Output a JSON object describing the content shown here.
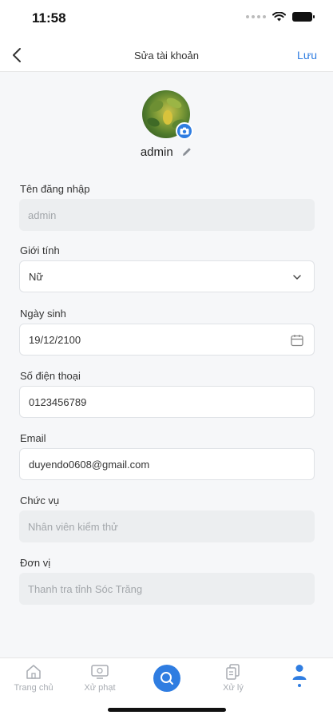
{
  "status_bar": {
    "time": "11:58"
  },
  "header": {
    "title": "Sửa tài khoản",
    "save_label": "Lưu"
  },
  "profile": {
    "username": "admin"
  },
  "fields": [
    {
      "label": "Tên đăng nhập",
      "value": "admin",
      "state": "disabled"
    },
    {
      "label": "Giới tính",
      "value": "Nữ",
      "state": "enabled",
      "icon": "chevron-down-icon"
    },
    {
      "label": "Ngày sinh",
      "value": "19/12/2100",
      "state": "enabled",
      "icon": "calendar-icon"
    },
    {
      "label": "Số điện thoại",
      "value": "0123456789",
      "state": "enabled"
    },
    {
      "label": "Email",
      "value": "duyendo0608@gmail.com",
      "state": "enabled"
    },
    {
      "label": "Chức vụ",
      "value": "Nhân viên kiểm thử",
      "state": "disabled"
    },
    {
      "label": "Đơn vị",
      "value": "Thanh tra tỉnh Sóc Trăng",
      "state": "disabled"
    }
  ],
  "bottom_nav": {
    "items": [
      {
        "label": "Trang chủ",
        "icon": "home-icon"
      },
      {
        "label": "Xử phạt",
        "icon": "monitor-icon"
      },
      {
        "label": "",
        "icon": "search-icon"
      },
      {
        "label": "Xử lý",
        "icon": "documents-icon"
      },
      {
        "label": "",
        "icon": "user-icon",
        "active": true
      }
    ]
  },
  "colors": {
    "accent": "#2f7de1",
    "disabled_bg": "#eceef0",
    "page_bg": "#f6f7f9"
  }
}
